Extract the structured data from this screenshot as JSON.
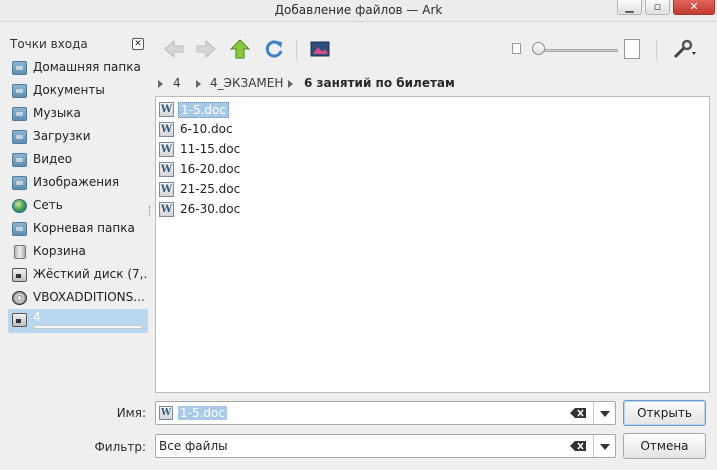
{
  "window": {
    "title": "Добавление файлов — Ark"
  },
  "places": {
    "header": "Точки входа",
    "items": [
      {
        "label": "Домашняя папка",
        "icon": "home-folder-icon"
      },
      {
        "label": "Документы",
        "icon": "documents-folder-icon"
      },
      {
        "label": "Музыка",
        "icon": "music-folder-icon"
      },
      {
        "label": "Загрузки",
        "icon": "downloads-folder-icon"
      },
      {
        "label": "Видео",
        "icon": "video-folder-icon"
      },
      {
        "label": "Изображения",
        "icon": "pictures-folder-icon"
      },
      {
        "label": "Сеть",
        "icon": "network-globe-icon"
      },
      {
        "label": "Корневая папка",
        "icon": "root-folder-icon"
      },
      {
        "label": "Корзина",
        "icon": "trash-icon"
      },
      {
        "label": "Жёсткий диск (7,...",
        "icon": "hard-drive-icon"
      },
      {
        "label": "VBOXADDITIONS...",
        "icon": "optical-disc-icon"
      },
      {
        "label": "4",
        "icon": "usb-drive-icon",
        "selected": true
      }
    ]
  },
  "breadcrumb": [
    "4",
    "4_ЭКЗАМЕН",
    "6 занятий по билетам"
  ],
  "files": [
    {
      "name": "1-5.doc",
      "selected": true
    },
    {
      "name": "6-10.doc"
    },
    {
      "name": "11-15.doc"
    },
    {
      "name": "16-20.doc"
    },
    {
      "name": "21-25.doc"
    },
    {
      "name": "26-30.doc"
    }
  ],
  "name_row": {
    "label": "Имя:",
    "value": "1-5.doc",
    "button": "Открыть"
  },
  "filter_row": {
    "label": "Фильтр:",
    "value": "Все файлы",
    "button": "Отмена"
  },
  "colors": {
    "selection": "#a9c9e8",
    "accent": "#6a9ad1",
    "close_button": "#c23a2f"
  }
}
